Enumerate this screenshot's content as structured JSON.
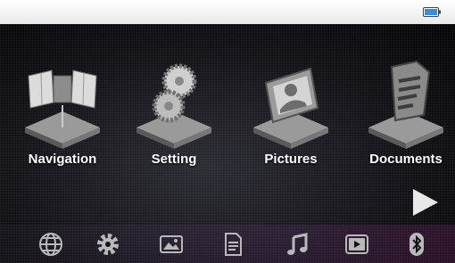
{
  "status_bar": {
    "battery_icon": "battery-icon"
  },
  "apps": [
    {
      "label": "Navigation",
      "icon": "satellite-icon"
    },
    {
      "label": "Setting",
      "icon": "gears-icon"
    },
    {
      "label": "Pictures",
      "icon": "picture-frame-icon"
    },
    {
      "label": "Documents",
      "icon": "document-icon"
    }
  ],
  "pager": {
    "icon": "next-page-arrow-icon"
  },
  "dock": [
    {
      "icon": "globe-icon"
    },
    {
      "icon": "gear-icon"
    },
    {
      "icon": "image-icon"
    },
    {
      "icon": "document-icon"
    },
    {
      "icon": "music-icon"
    },
    {
      "icon": "video-icon"
    },
    {
      "icon": "bluetooth-icon"
    }
  ],
  "colors": {
    "status_bar": "#f2f2f2",
    "battery_fill": "#3a8dd6",
    "label": "#ffffff",
    "dock_icon": "#b9b9b9"
  }
}
